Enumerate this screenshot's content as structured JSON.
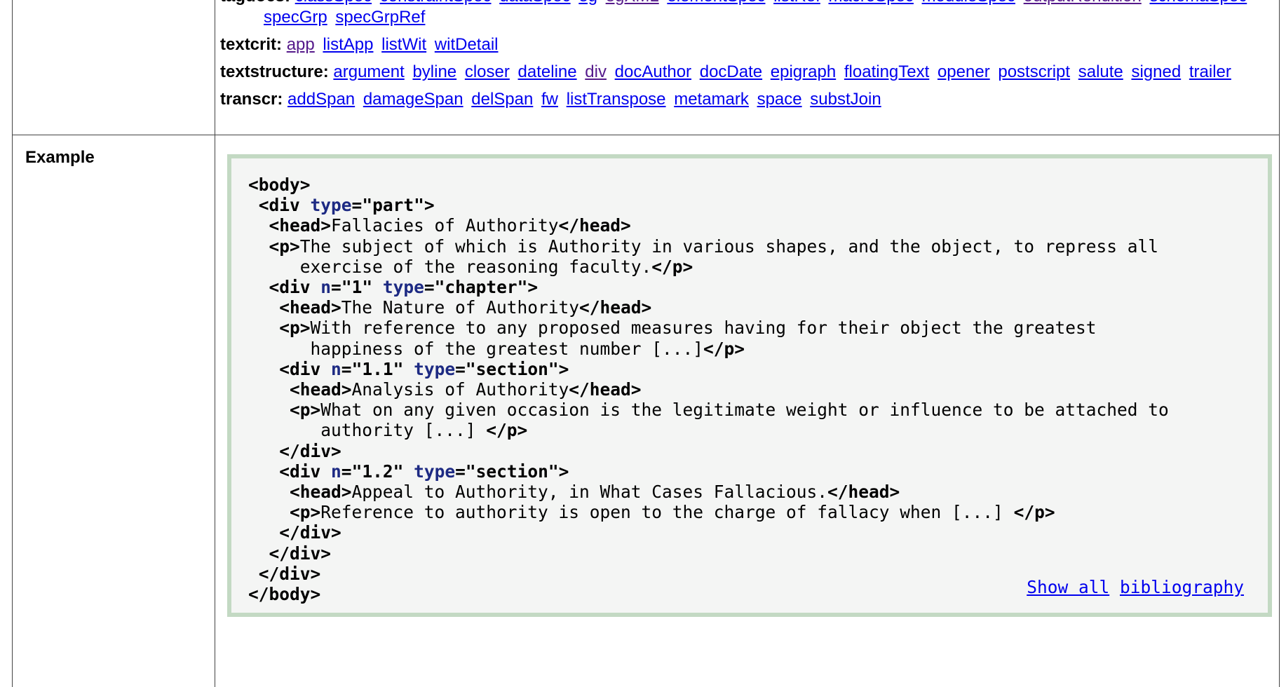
{
  "module_rows": [
    {
      "name": "tagdocs:",
      "links": [
        {
          "text": "classSpec",
          "visited": false
        },
        {
          "text": "constraintSpec",
          "visited": false
        },
        {
          "text": "dataSpec",
          "visited": false
        },
        {
          "text": "eg",
          "visited": false
        },
        {
          "text": "egXML",
          "visited": true
        },
        {
          "text": "elementSpec",
          "visited": false
        },
        {
          "text": "listRef",
          "visited": false
        },
        {
          "text": "macroSpec",
          "visited": false
        },
        {
          "text": "moduleSpec",
          "visited": false
        },
        {
          "text": "outputRendition",
          "visited": true
        },
        {
          "text": "schemaSpec",
          "visited": false
        },
        {
          "text": "specGrp",
          "visited": false
        },
        {
          "text": "specGrpRef",
          "visited": false
        }
      ]
    },
    {
      "name": "textcrit:",
      "links": [
        {
          "text": "app",
          "visited": true
        },
        {
          "text": "listApp",
          "visited": false
        },
        {
          "text": "listWit",
          "visited": false
        },
        {
          "text": "witDetail",
          "visited": false
        }
      ]
    },
    {
      "name": "textstructure:",
      "links": [
        {
          "text": "argument",
          "visited": false
        },
        {
          "text": "byline",
          "visited": false
        },
        {
          "text": "closer",
          "visited": false
        },
        {
          "text": "dateline",
          "visited": false
        },
        {
          "text": "div",
          "visited": true
        },
        {
          "text": "docAuthor",
          "visited": false
        },
        {
          "text": "docDate",
          "visited": false
        },
        {
          "text": "epigraph",
          "visited": false
        },
        {
          "text": "floatingText",
          "visited": false
        },
        {
          "text": "opener",
          "visited": false
        },
        {
          "text": "postscript",
          "visited": false
        },
        {
          "text": "salute",
          "visited": false
        },
        {
          "text": "signed",
          "visited": false
        },
        {
          "text": "trailer",
          "visited": false
        }
      ]
    },
    {
      "name": "transcr:",
      "links": [
        {
          "text": "addSpan",
          "visited": false
        },
        {
          "text": "damageSpan",
          "visited": false
        },
        {
          "text": "delSpan",
          "visited": false
        },
        {
          "text": "fw",
          "visited": false
        },
        {
          "text": "listTranspose",
          "visited": false
        },
        {
          "text": "metamark",
          "visited": false
        },
        {
          "text": "space",
          "visited": false
        },
        {
          "text": "substJoin",
          "visited": false
        }
      ]
    }
  ],
  "example": {
    "label": "Example",
    "code_lines": [
      [
        {
          "c": "tag",
          "t": "<body>"
        }
      ],
      [
        {
          "c": "",
          "t": " "
        },
        {
          "c": "tag",
          "t": "<div "
        },
        {
          "c": "attr",
          "t": "type"
        },
        {
          "c": "tag",
          "t": "="
        },
        {
          "c": "val",
          "t": "\"part\""
        },
        {
          "c": "tag",
          "t": ">"
        }
      ],
      [
        {
          "c": "",
          "t": "  "
        },
        {
          "c": "tag",
          "t": "<head>"
        },
        {
          "c": "",
          "t": "Fallacies of Authority"
        },
        {
          "c": "tag",
          "t": "</head>"
        }
      ],
      [
        {
          "c": "",
          "t": "  "
        },
        {
          "c": "tag",
          "t": "<p>"
        },
        {
          "c": "",
          "t": "The subject of which is Authority in various shapes, and the object, to repress all"
        }
      ],
      [
        {
          "c": "",
          "t": "     exercise of the reasoning faculty."
        },
        {
          "c": "tag",
          "t": "</p>"
        }
      ],
      [
        {
          "c": "",
          "t": "  "
        },
        {
          "c": "tag",
          "t": "<div "
        },
        {
          "c": "attr",
          "t": "n"
        },
        {
          "c": "tag",
          "t": "="
        },
        {
          "c": "val",
          "t": "\"1\" "
        },
        {
          "c": "attr",
          "t": "type"
        },
        {
          "c": "tag",
          "t": "="
        },
        {
          "c": "val",
          "t": "\"chapter\""
        },
        {
          "c": "tag",
          "t": ">"
        }
      ],
      [
        {
          "c": "",
          "t": "   "
        },
        {
          "c": "tag",
          "t": "<head>"
        },
        {
          "c": "",
          "t": "The Nature of Authority"
        },
        {
          "c": "tag",
          "t": "</head>"
        }
      ],
      [
        {
          "c": "",
          "t": "   "
        },
        {
          "c": "tag",
          "t": "<p>"
        },
        {
          "c": "",
          "t": "With reference to any proposed measures having for their object the greatest"
        }
      ],
      [
        {
          "c": "",
          "t": "      happiness of the greatest number [...]"
        },
        {
          "c": "tag",
          "t": "</p>"
        }
      ],
      [
        {
          "c": "",
          "t": "   "
        },
        {
          "c": "tag",
          "t": "<div "
        },
        {
          "c": "attr",
          "t": "n"
        },
        {
          "c": "tag",
          "t": "="
        },
        {
          "c": "val",
          "t": "\"1.1\" "
        },
        {
          "c": "attr",
          "t": "type"
        },
        {
          "c": "tag",
          "t": "="
        },
        {
          "c": "val",
          "t": "\"section\""
        },
        {
          "c": "tag",
          "t": ">"
        }
      ],
      [
        {
          "c": "",
          "t": "    "
        },
        {
          "c": "tag",
          "t": "<head>"
        },
        {
          "c": "",
          "t": "Analysis of Authority"
        },
        {
          "c": "tag",
          "t": "</head>"
        }
      ],
      [
        {
          "c": "",
          "t": "    "
        },
        {
          "c": "tag",
          "t": "<p>"
        },
        {
          "c": "",
          "t": "What on any given occasion is the legitimate weight or influence to be attached to"
        }
      ],
      [
        {
          "c": "",
          "t": "       authority [...] "
        },
        {
          "c": "tag",
          "t": "</p>"
        }
      ],
      [
        {
          "c": "",
          "t": "   "
        },
        {
          "c": "tag",
          "t": "</div>"
        }
      ],
      [
        {
          "c": "",
          "t": "   "
        },
        {
          "c": "tag",
          "t": "<div "
        },
        {
          "c": "attr",
          "t": "n"
        },
        {
          "c": "tag",
          "t": "="
        },
        {
          "c": "val",
          "t": "\"1.2\" "
        },
        {
          "c": "attr",
          "t": "type"
        },
        {
          "c": "tag",
          "t": "="
        },
        {
          "c": "val",
          "t": "\"section\""
        },
        {
          "c": "tag",
          "t": ">"
        }
      ],
      [
        {
          "c": "",
          "t": "    "
        },
        {
          "c": "tag",
          "t": "<head>"
        },
        {
          "c": "",
          "t": "Appeal to Authority, in What Cases Fallacious."
        },
        {
          "c": "tag",
          "t": "</head>"
        }
      ],
      [
        {
          "c": "",
          "t": "    "
        },
        {
          "c": "tag",
          "t": "<p>"
        },
        {
          "c": "",
          "t": "Reference to authority is open to the charge of fallacy when [...] "
        },
        {
          "c": "tag",
          "t": "</p>"
        }
      ],
      [
        {
          "c": "",
          "t": "   "
        },
        {
          "c": "tag",
          "t": "</div>"
        }
      ],
      [
        {
          "c": "",
          "t": "  "
        },
        {
          "c": "tag",
          "t": "</div>"
        }
      ],
      [
        {
          "c": "",
          "t": " "
        },
        {
          "c": "tag",
          "t": "</div>"
        }
      ],
      [
        {
          "c": "tag",
          "t": "</body>"
        }
      ]
    ],
    "show_all_label": "Show all",
    "bibliography_label": "bibliography"
  }
}
